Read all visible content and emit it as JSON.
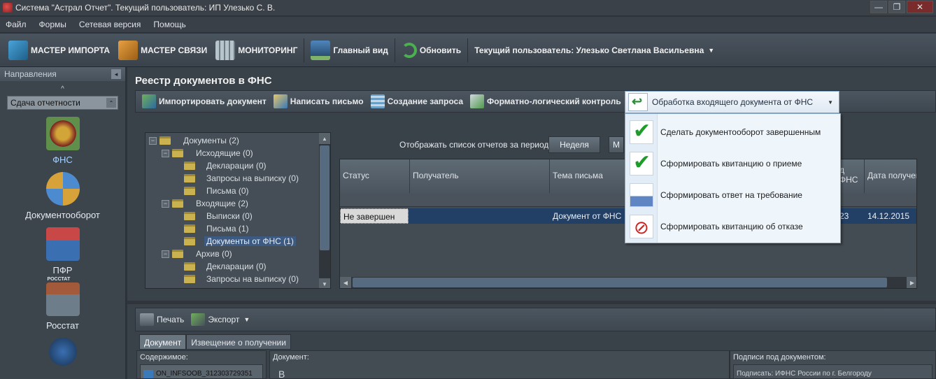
{
  "window": {
    "title": "Система \"Астрал Отчет\". Текущий пользователь: ИП Улезько С. В.",
    "controls": [
      "—",
      "❐",
      "✕"
    ]
  },
  "menu": [
    "Файл",
    "Формы",
    "Сетевая версия",
    "Помощь"
  ],
  "toolbar": {
    "import": "МАСТЕР ИМПОРТА",
    "link": "МАСТЕР СВЯЗИ",
    "monitor": "МОНИТОРИНГ",
    "main_view": "Главный вид",
    "refresh": "Обновить",
    "current_user": "Текущий пользователь: Улезько Светлана Васильевна"
  },
  "sidebar": {
    "header": "Направления",
    "selector": "Сдача отчетности",
    "items": [
      "ФНС",
      "Документооборот",
      "ПФР",
      "Росстат"
    ],
    "rosstat_badge": "РОССТАТ"
  },
  "registry": {
    "title": "Реестр документов в ФНС",
    "actions": {
      "import_doc": "Импортировать документ",
      "write_letter": "Написать письмо",
      "create_query": "Создание запроса",
      "flk": "Форматно-логический контроль"
    }
  },
  "tree": [
    {
      "label": "Документы (2)",
      "level": 0,
      "kind": "root"
    },
    {
      "label": "Исходящие (0)",
      "level": 1,
      "kind": "group"
    },
    {
      "label": "Декларации (0)",
      "level": 2,
      "kind": "leaf"
    },
    {
      "label": "Запросы на выписку (0)",
      "level": 2,
      "kind": "leaf"
    },
    {
      "label": "Письма (0)",
      "level": 2,
      "kind": "leaf"
    },
    {
      "label": "Входящие (2)",
      "level": 1,
      "kind": "group"
    },
    {
      "label": "Выписки (0)",
      "level": 2,
      "kind": "leaf"
    },
    {
      "label": "Письма (1)",
      "level": 2,
      "kind": "leaf"
    },
    {
      "label": "Документы от ФНС (1)",
      "level": 2,
      "kind": "leaf",
      "selected": true
    },
    {
      "label": "Архив (0)",
      "level": 1,
      "kind": "group"
    },
    {
      "label": "Декларации (0)",
      "level": 2,
      "kind": "leaf"
    },
    {
      "label": "Запросы на выписку (0)",
      "level": 2,
      "kind": "leaf"
    }
  ],
  "period": {
    "label": "Отображать список отчетов за период:",
    "week": "Неделя",
    "month_partial": "М"
  },
  "grid": {
    "columns": [
      "Статус",
      "Получатель",
      "Тема письма",
      "д\nФНС",
      "Дата получен"
    ],
    "row": {
      "status": "Не завершен",
      "recipient": "",
      "subject": "Документ от ФНС",
      "code": "23",
      "date": "14.12.2015"
    }
  },
  "bottom": {
    "print": "Печать",
    "export": "Экспорт",
    "tabs": [
      "Документ",
      "Извещение о получении"
    ],
    "contents_label": "Содержимое:",
    "contents_file": "ON_INFSOOB_312303729351",
    "document_label": "Документ:",
    "document_text": "В",
    "signatures_label": "Подписи под документом:",
    "signatures_text": "Подписать: ИФНС России по г. Белгороду"
  },
  "popup": {
    "header": "Обработка входящего документа от ФНС",
    "items": [
      {
        "label": "Сделать документооборот завершенным",
        "icon": "check-icon"
      },
      {
        "label": "Сформировать квитанцию о приеме",
        "icon": "check-icon"
      },
      {
        "label": "Сформировать ответ на требование",
        "icon": "answer-icon"
      },
      {
        "label": "Сформировать квитанцию об отказе",
        "icon": "reject-icon"
      }
    ]
  }
}
